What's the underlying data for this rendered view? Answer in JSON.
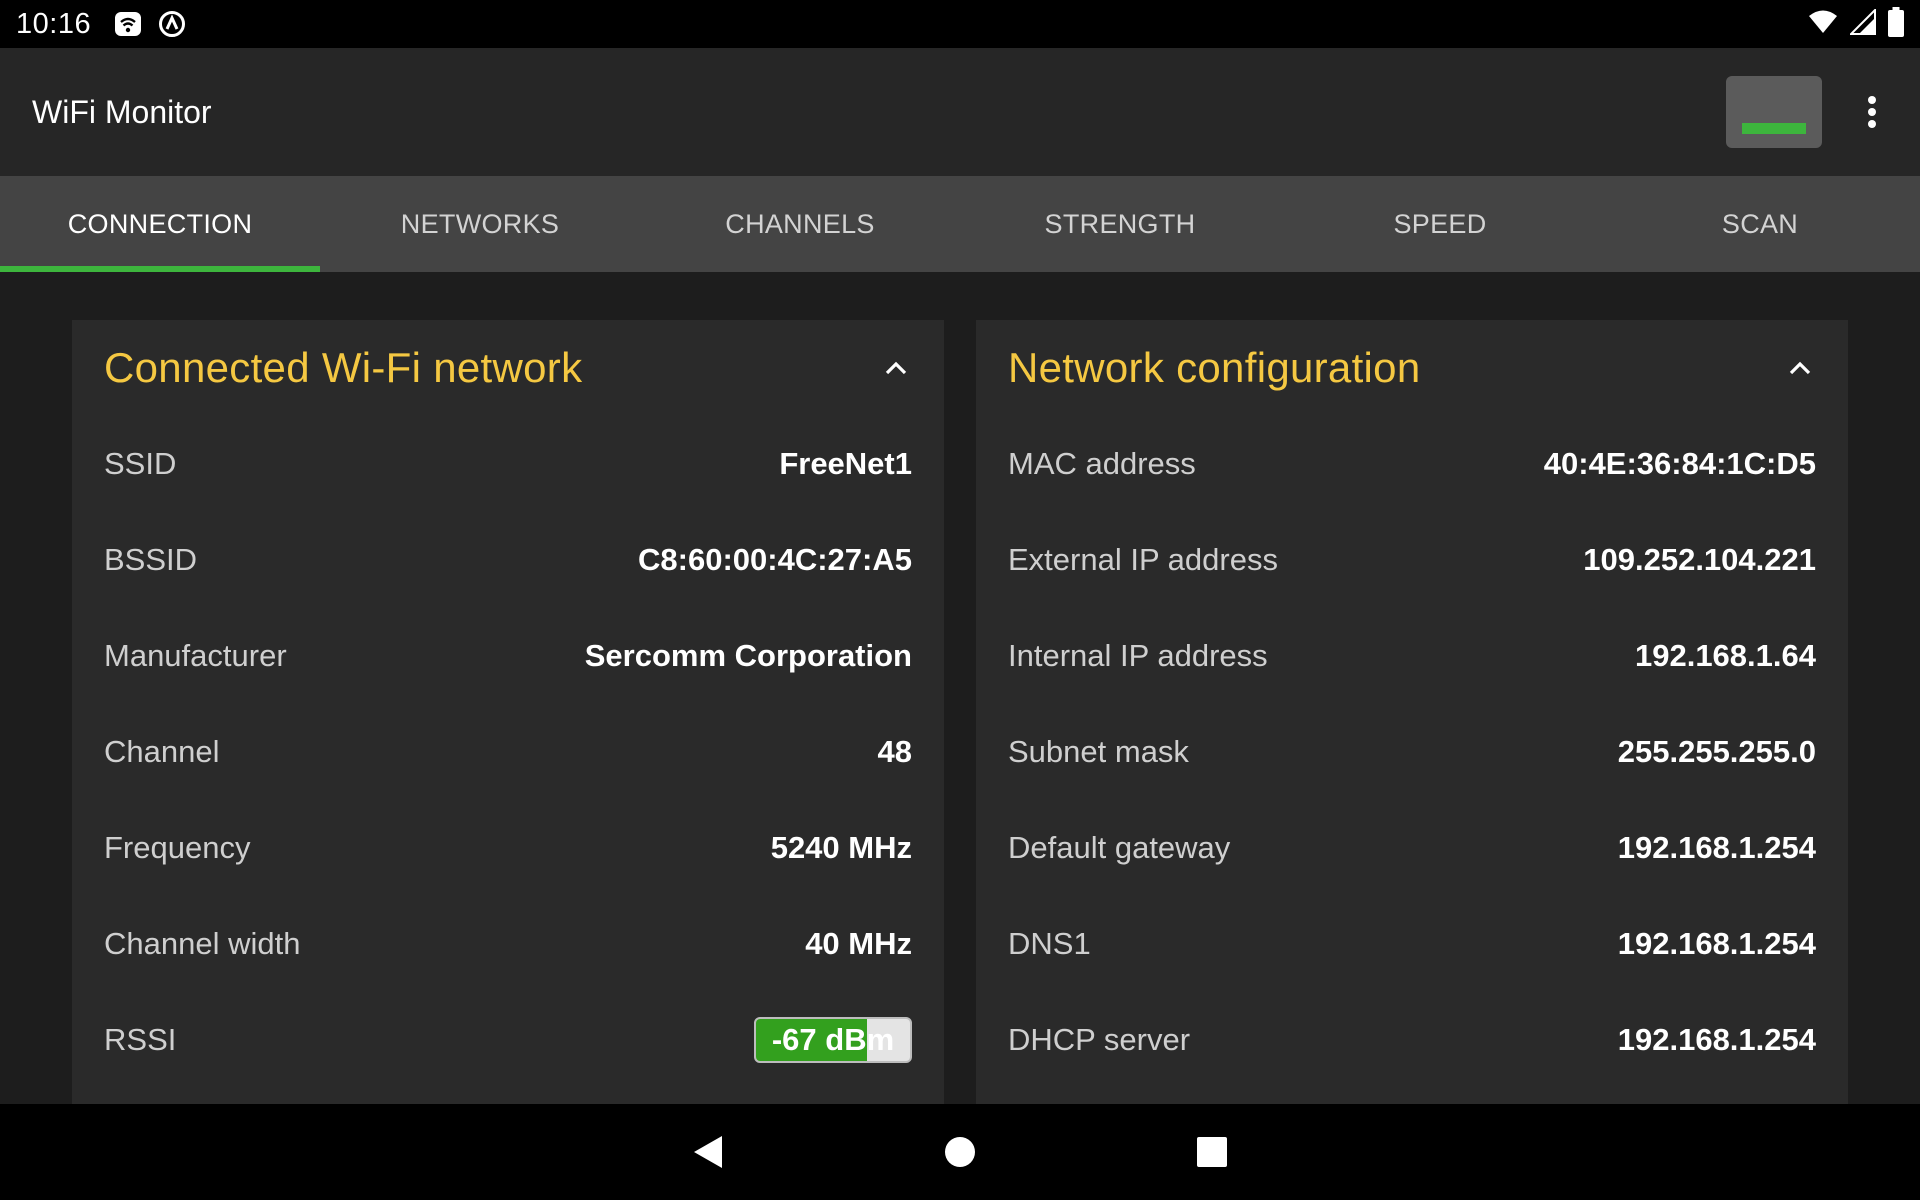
{
  "status_bar": {
    "time": "10:16",
    "left_icons": [
      "wifi-notification-icon",
      "vpn-key-icon"
    ],
    "right_icons": [
      "wifi-signal-icon",
      "cell-signal-icon",
      "battery-icon"
    ]
  },
  "app_bar": {
    "title": "WiFi Monitor",
    "signal_widget_icon": "mini-signal-meter",
    "menu_icon": "more-vert-icon",
    "accent": "#3db53d"
  },
  "tabs": [
    {
      "label": "CONNECTION",
      "active": true
    },
    {
      "label": "NETWORKS",
      "active": false
    },
    {
      "label": "CHANNELS",
      "active": false
    },
    {
      "label": "STRENGTH",
      "active": false
    },
    {
      "label": "SPEED",
      "active": false
    },
    {
      "label": "SCAN",
      "active": false
    }
  ],
  "connected_card": {
    "title": "Connected Wi-Fi network",
    "title_color": "#f5c842",
    "rows": [
      {
        "label": "SSID",
        "value": "FreeNet1"
      },
      {
        "label": "BSSID",
        "value": "C8:60:00:4C:27:A5"
      },
      {
        "label": "Manufacturer",
        "value": "Sercomm Corporation"
      },
      {
        "label": "Channel",
        "value": "48"
      },
      {
        "label": "Frequency",
        "value": "5240 MHz"
      },
      {
        "label": "Channel width",
        "value": "40 MHz"
      }
    ],
    "rssi": {
      "label": "RSSI",
      "value": "-67 dBm",
      "level_percent": 72,
      "level_color": "#33a01e"
    }
  },
  "config_card": {
    "title": "Network configuration",
    "rows": [
      {
        "label": "MAC address",
        "value": "40:4E:36:84:1C:D5"
      },
      {
        "label": "External IP address",
        "value": "109.252.104.221"
      },
      {
        "label": "Internal IP address",
        "value": "192.168.1.64"
      },
      {
        "label": "Subnet mask",
        "value": "255.255.255.0"
      },
      {
        "label": "Default gateway",
        "value": "192.168.1.254"
      },
      {
        "label": "DNS1",
        "value": "192.168.1.254"
      },
      {
        "label": "DHCP server",
        "value": "192.168.1.254"
      }
    ]
  },
  "nav_bar": {
    "buttons": [
      "back-icon",
      "home-icon",
      "recents-icon"
    ]
  }
}
